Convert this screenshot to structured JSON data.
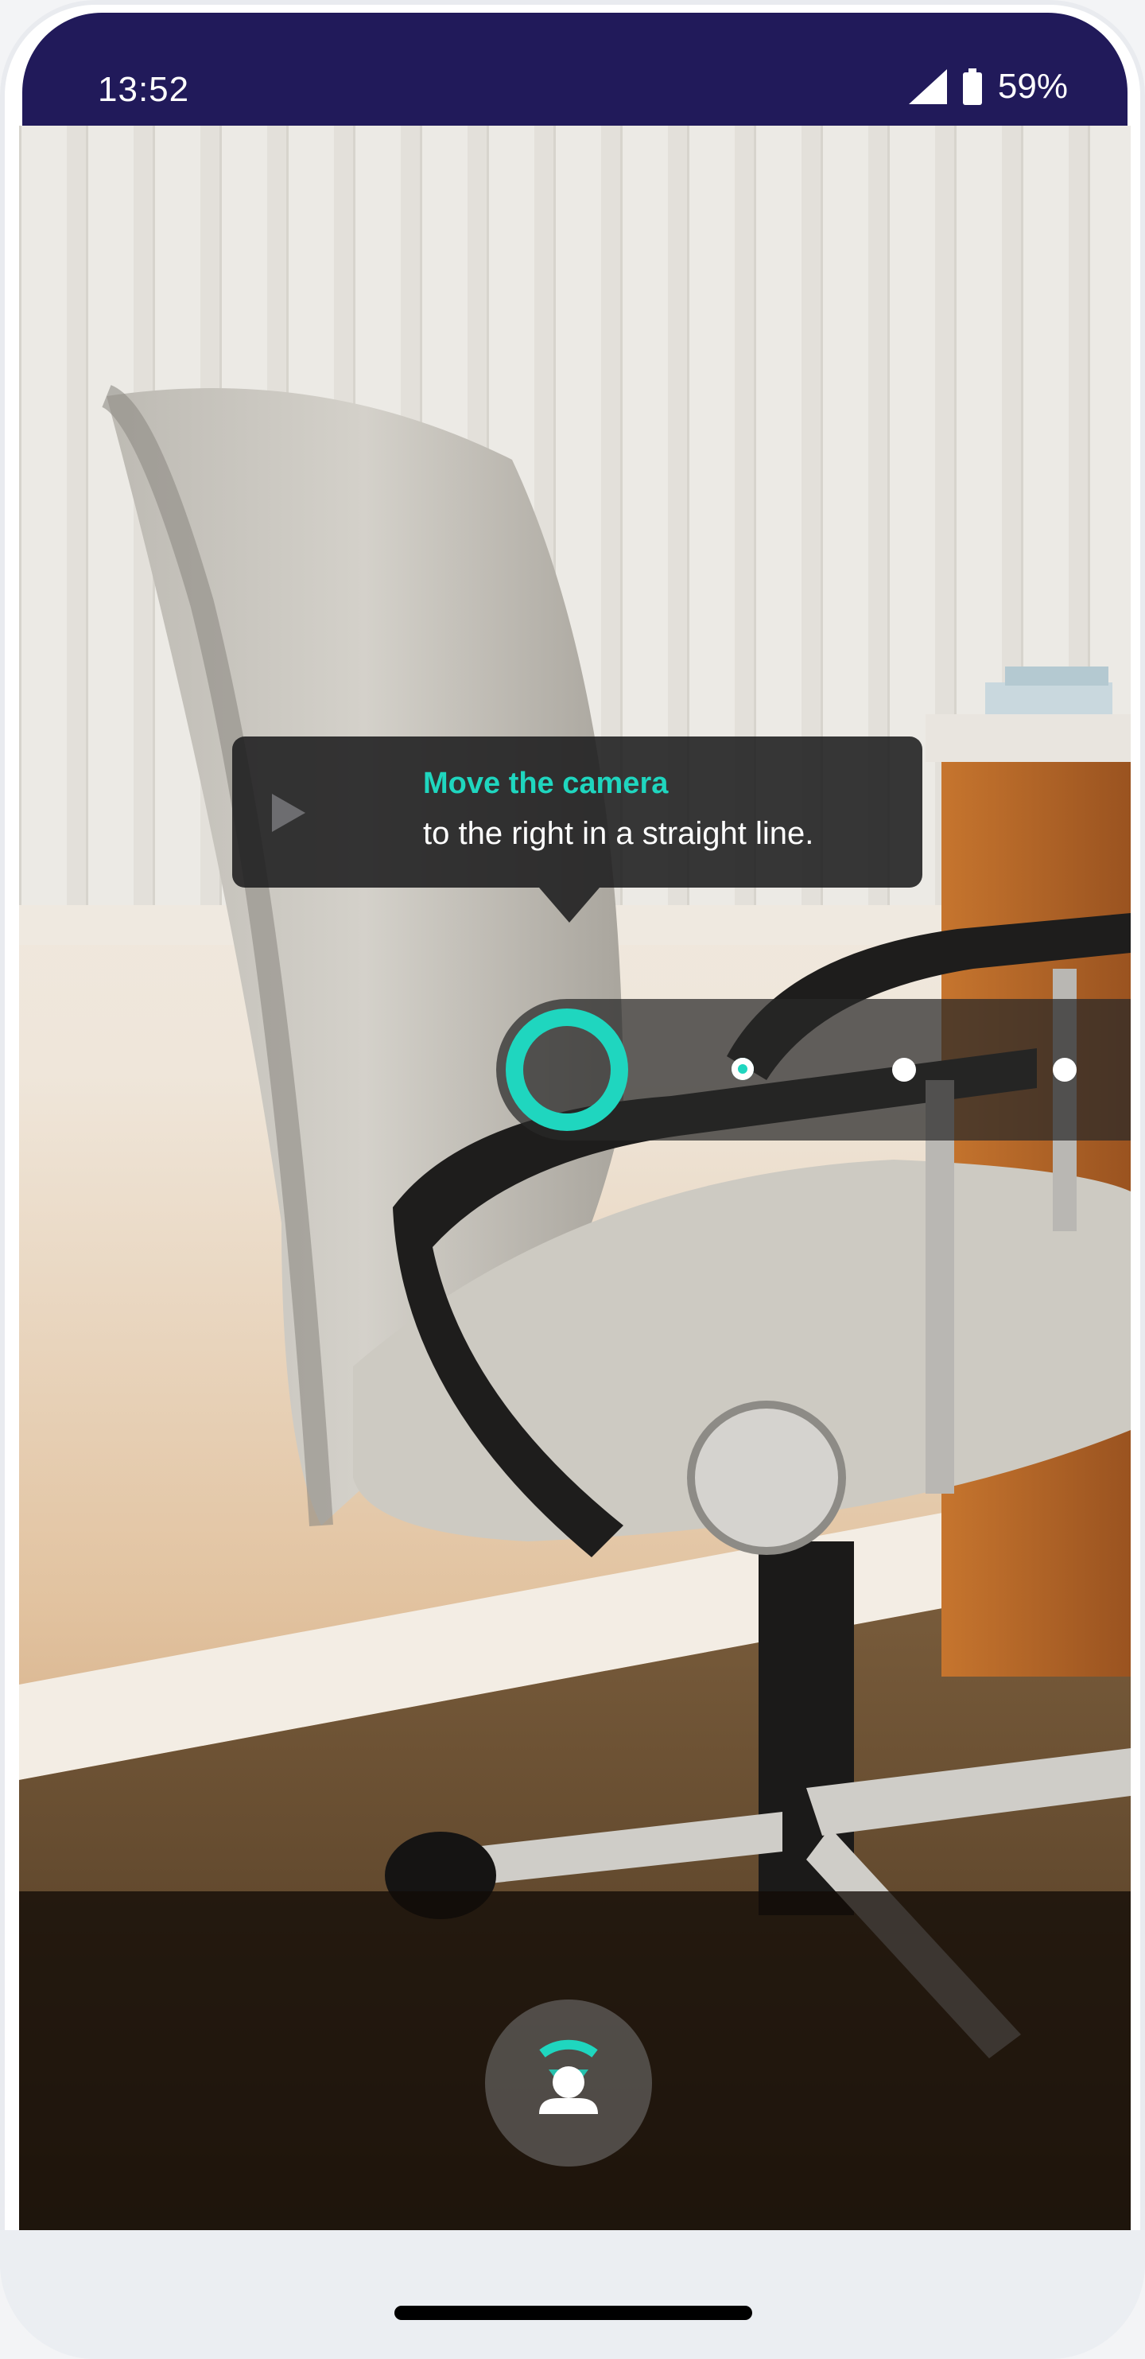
{
  "status_bar": {
    "time": "13:52",
    "battery": "59%",
    "icons": [
      "signal-icon",
      "battery-icon"
    ]
  },
  "hint": {
    "title": "Move the camera",
    "text": "to the right in a straight line.",
    "icon": "play-icon"
  },
  "progress": {
    "steps_total": 4,
    "current_step": 1,
    "accent_color": "#1fd6bf"
  },
  "capture": {
    "icon": "person-scan-icon"
  },
  "colors": {
    "status_bar": "#211a5a",
    "accent": "#1fd6bf"
  }
}
